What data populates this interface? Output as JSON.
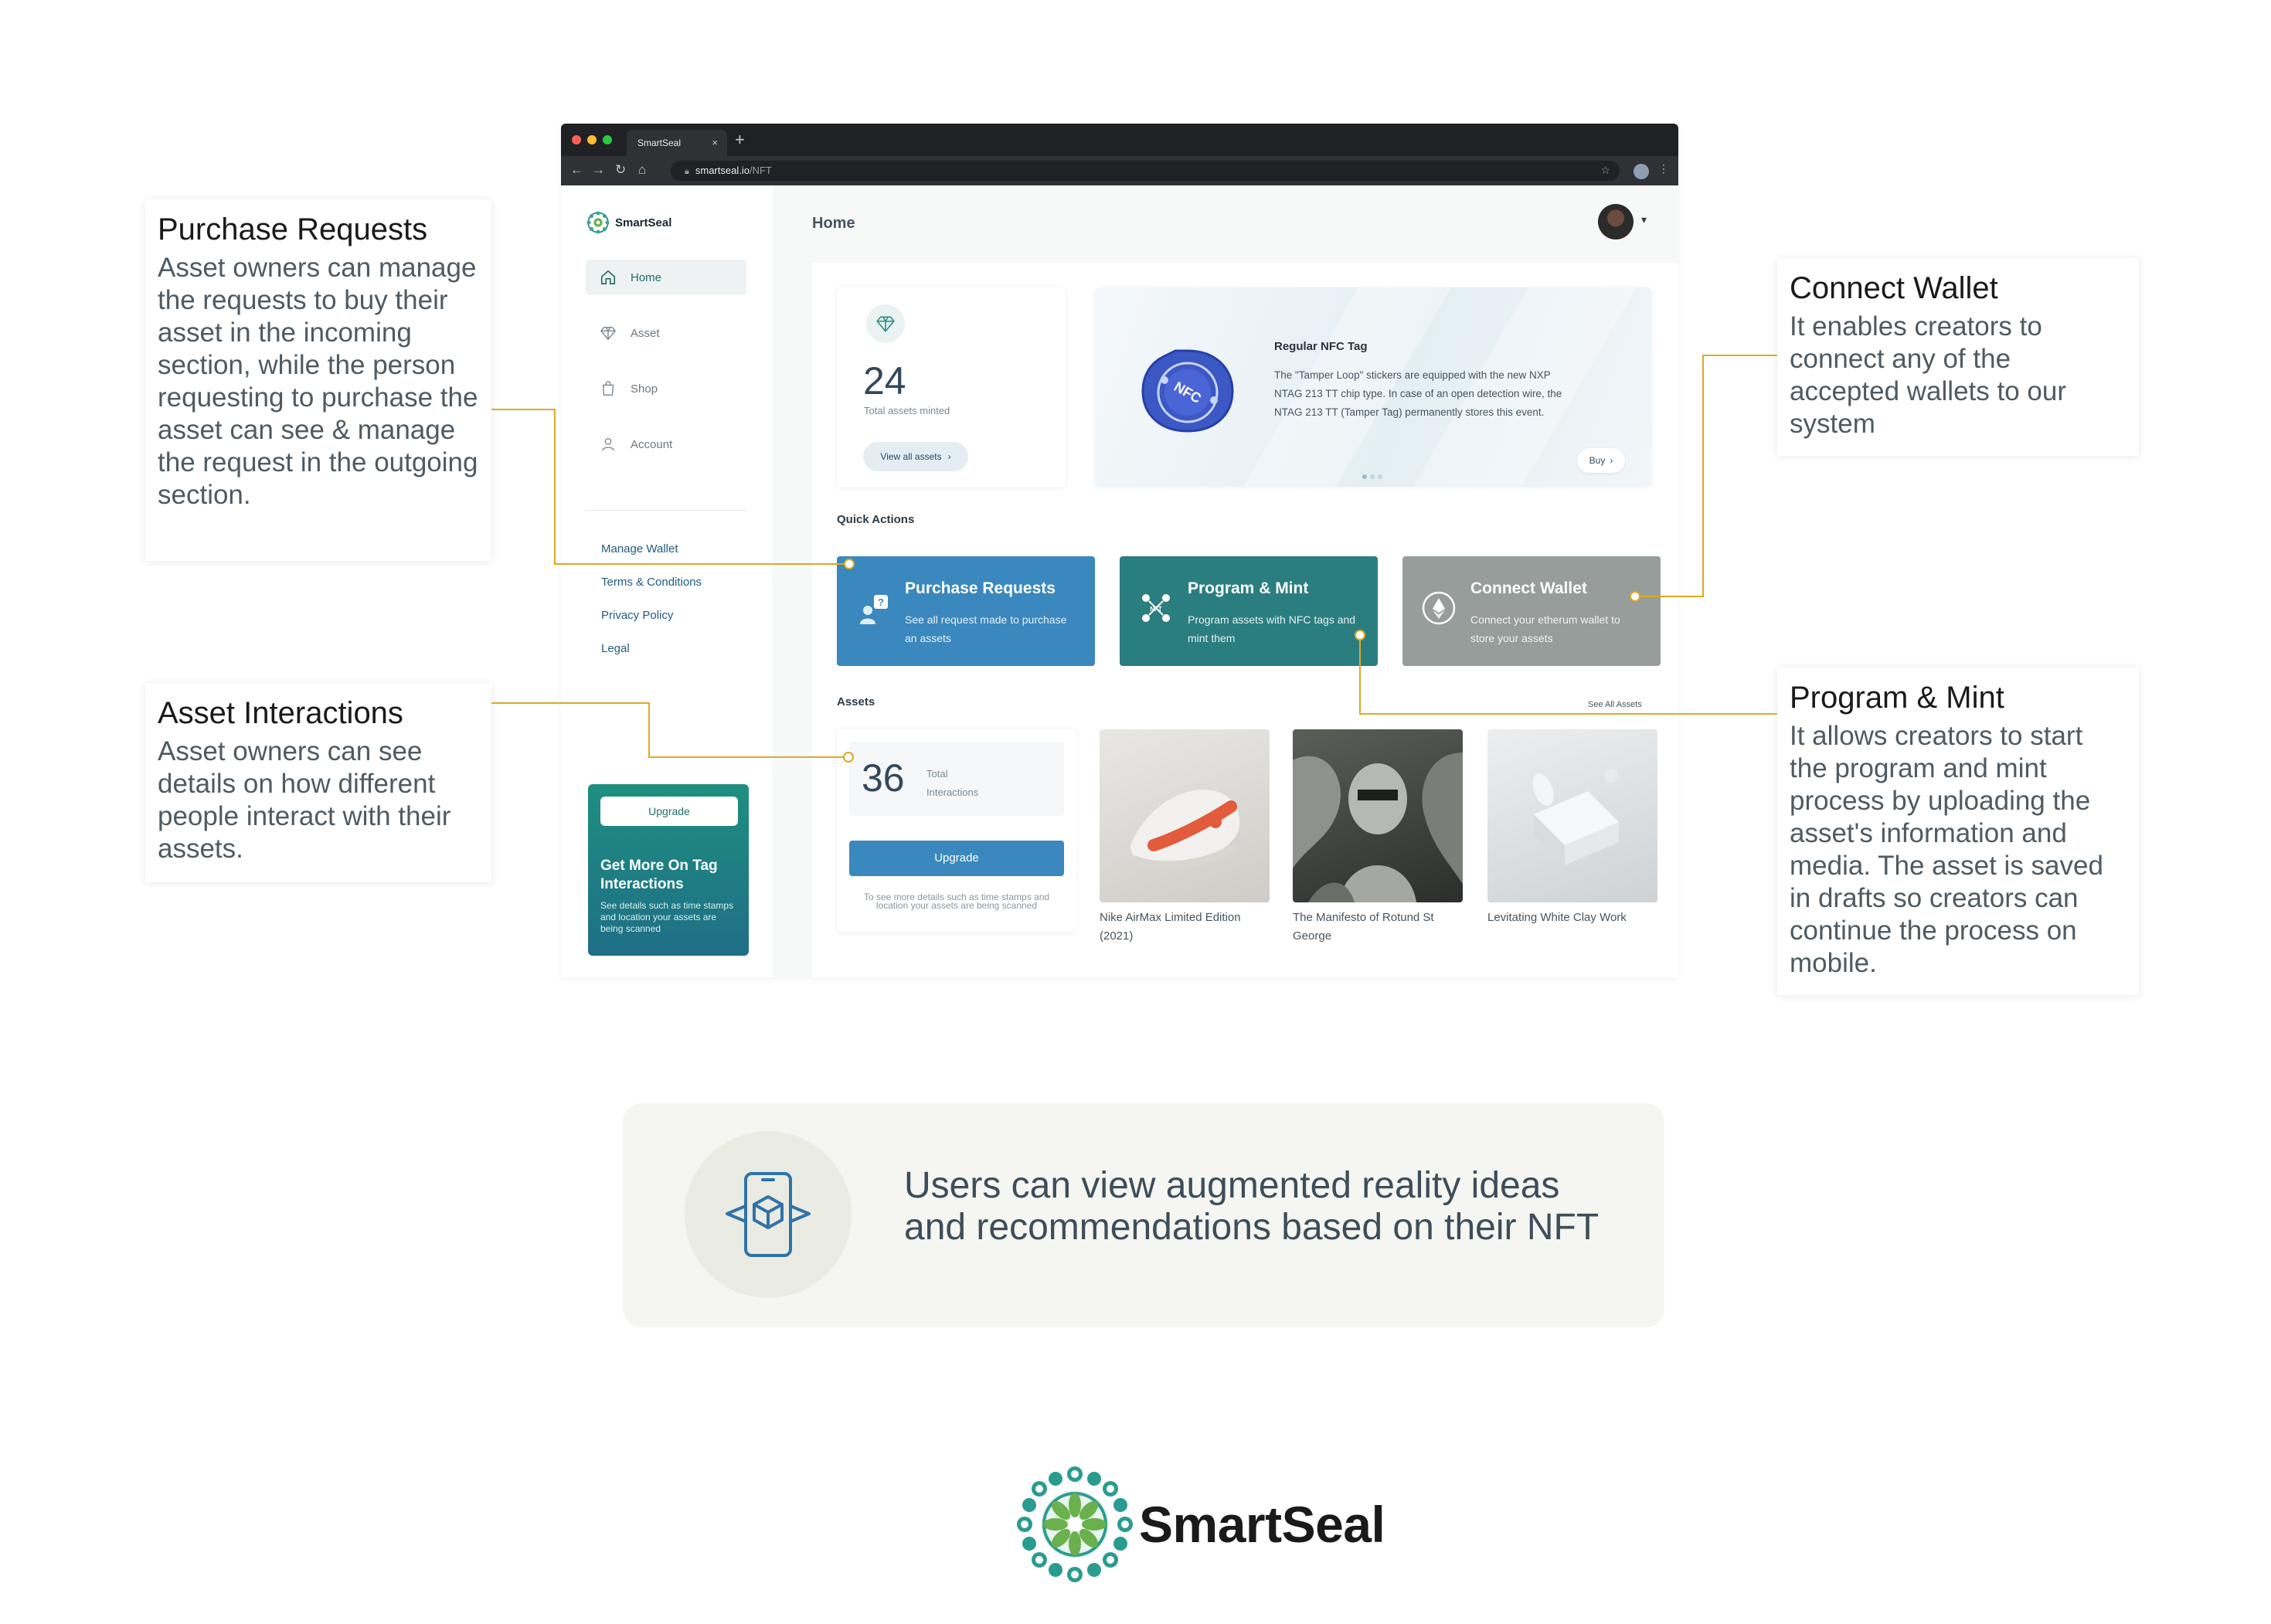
{
  "browser": {
    "tab_title": "SmartSeal",
    "tab_close": "×",
    "new_tab": "+",
    "url_host": "smartseal.io",
    "url_path": "/NFT"
  },
  "sidebar": {
    "brand": "SmartSeal",
    "nav": [
      {
        "label": "Home",
        "icon": "home-icon",
        "active": true
      },
      {
        "label": "Asset",
        "icon": "diamond-icon",
        "active": false
      },
      {
        "label": "Shop",
        "icon": "bag-icon",
        "active": false
      },
      {
        "label": "Account",
        "icon": "user-icon",
        "active": false
      }
    ],
    "links": [
      "Manage  Wallet",
      "Terms & Conditions",
      "Privacy Policy",
      "Legal"
    ],
    "upgrade_card": {
      "button": "Upgrade",
      "title": "Get More On Tag Interactions",
      "desc": "See details such as time stamps and location your assets are being scanned"
    }
  },
  "header": {
    "title": "Home"
  },
  "stats": {
    "value": "24",
    "label": "Total assets minted",
    "button": "View all assets"
  },
  "nfc_banner": {
    "title": "Regular NFC Tag",
    "desc": "The \"Tamper Loop\" stickers are equipped with the new NXP NTAG 213 TT chip type. In case of an open detection wire, the NTAG 213 TT (Tamper Tag) permanently stores this event.",
    "button": "Buy",
    "tag_text": "NFC"
  },
  "quick_actions": {
    "label": "Quick Actions",
    "cards": [
      {
        "title": "Purchase Requests",
        "desc": "See all request made to purchase an assets",
        "color": "#3a88bd"
      },
      {
        "title": "Program & Mint",
        "desc": "Program assets with NFC tags and mint them",
        "color": "#2b7e80"
      },
      {
        "title": "Connect Wallet",
        "desc": "Connect your etherum wallet to store your assets",
        "color": "#969d9b"
      }
    ]
  },
  "assets": {
    "label": "Assets",
    "see_all": "See All Assets",
    "interactions": {
      "value": "36",
      "label": "Total Interactions",
      "button": "Upgrade",
      "note": "To see more details such as time  stamps and location your assets are being scanned"
    },
    "items": [
      {
        "caption": "Nike AirMax Limited Edition (2021)"
      },
      {
        "caption": "The Manifesto of Rotund St George"
      },
      {
        "caption": "Levitating White Clay Work"
      }
    ]
  },
  "callouts": {
    "purchase": {
      "title": "Purchase Requests",
      "desc": "Asset owners can manage the requests to buy their asset in the incoming section, while the person requesting to purchase the asset can see & manage the request in the outgoing section."
    },
    "interactions": {
      "title": "Asset Interactions",
      "desc": "Asset owners can see details on how different people interact with their assets."
    },
    "wallet": {
      "title": "Connect Wallet",
      "desc": "It enables creators to connect any of the accepted wallets to our system"
    },
    "mint": {
      "title": "Program & Mint",
      "desc": "It allows creators to start the program and mint process by uploading the asset's information and media. The asset is saved in drafts so creators can continue the process on mobile."
    }
  },
  "ar_banner": {
    "text": "Users can view augmented reality ideas and recommendations based on their NFT",
    "icon": "ar-phone-icon"
  },
  "footer": {
    "brand": "SmartSeal"
  },
  "colors": {
    "accent_blue": "#3a88bd",
    "accent_teal": "#2b7e80",
    "connector": "#e0a823"
  }
}
